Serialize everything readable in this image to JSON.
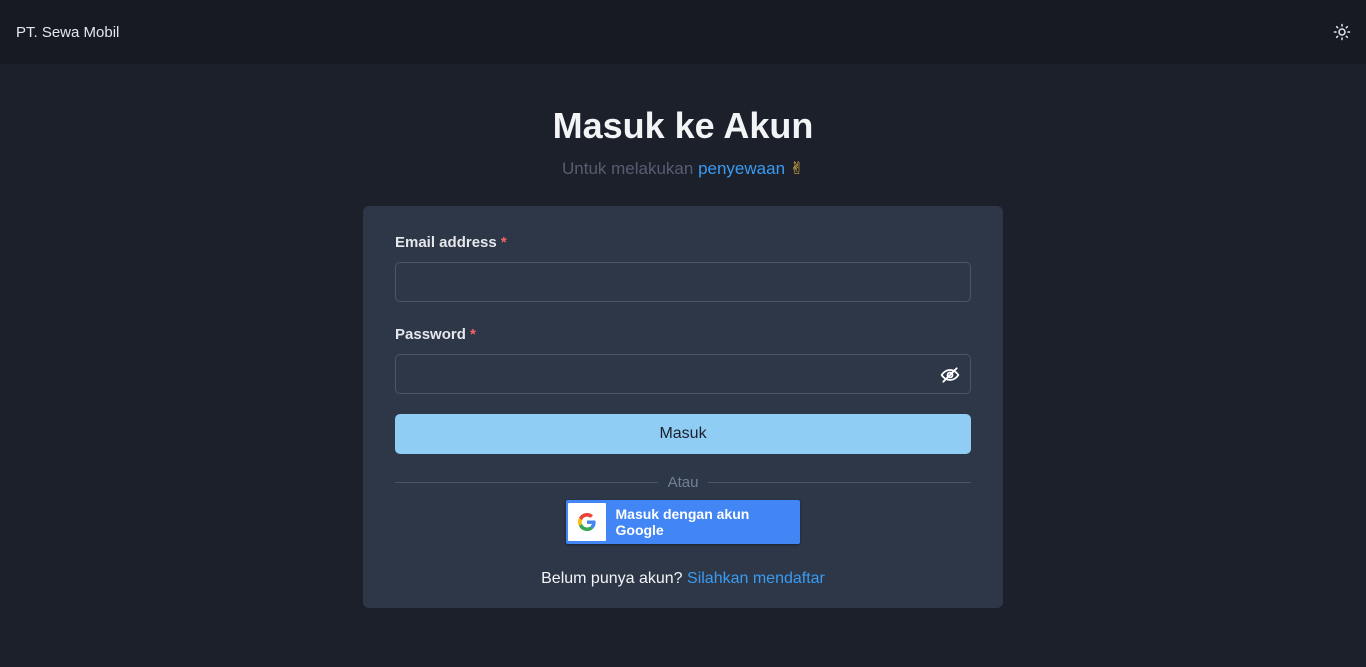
{
  "navbar": {
    "brand": "PT. Sewa Mobil",
    "theme_icon": "sun-icon"
  },
  "header": {
    "title": "Masuk ke Akun",
    "subtitle_prefix": "Untuk melakukan",
    "subtitle_accent": "penyewaan",
    "subtitle_emoji": "✌"
  },
  "form": {
    "email_label": "Email address",
    "email_value": "",
    "password_label": "Password",
    "password_value": "",
    "required_mark": "*",
    "password_toggle_icon": "eye-off-icon",
    "submit_label": "Masuk",
    "divider_text": "Atau",
    "google_label": "Masuk dengan akun Google",
    "register_prompt": "Belum punya akun?",
    "register_link": "Silahkan mendaftar"
  },
  "colors": {
    "background": "#1b202b",
    "navbar": "#171a22",
    "card": "#2d3748",
    "accent": "#3b9bf0",
    "submit_button": "#90cdf4",
    "google_blue": "#4285f4",
    "required": "#f56565"
  }
}
